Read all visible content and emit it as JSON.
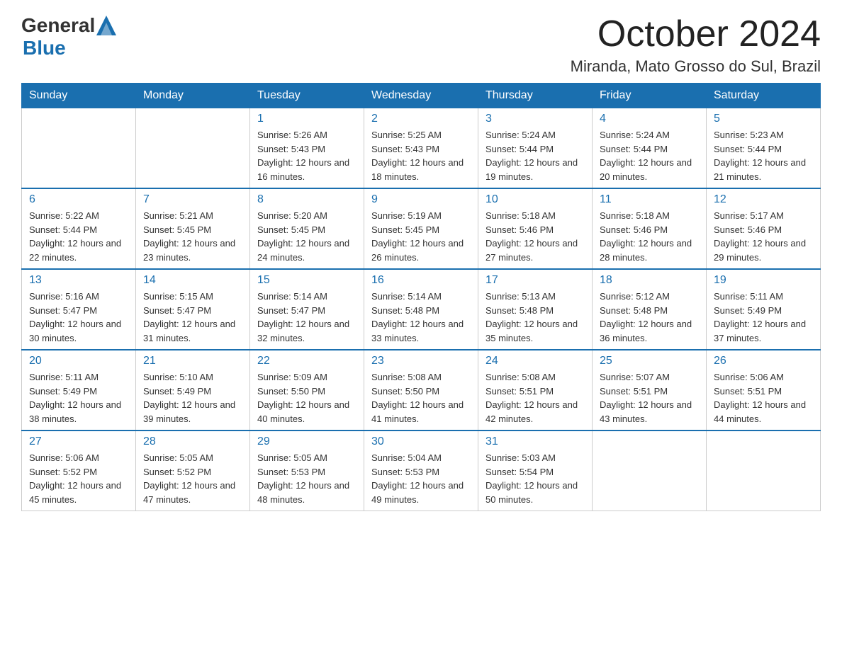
{
  "logo": {
    "text_general": "General",
    "text_blue": "Blue",
    "aria": "GeneralBlue logo"
  },
  "title": "October 2024",
  "subtitle": "Miranda, Mato Grosso do Sul, Brazil",
  "weekdays": [
    "Sunday",
    "Monday",
    "Tuesday",
    "Wednesday",
    "Thursday",
    "Friday",
    "Saturday"
  ],
  "weeks": [
    [
      {
        "day": "",
        "sunrise": "",
        "sunset": "",
        "daylight": ""
      },
      {
        "day": "",
        "sunrise": "",
        "sunset": "",
        "daylight": ""
      },
      {
        "day": "1",
        "sunrise": "Sunrise: 5:26 AM",
        "sunset": "Sunset: 5:43 PM",
        "daylight": "Daylight: 12 hours and 16 minutes."
      },
      {
        "day": "2",
        "sunrise": "Sunrise: 5:25 AM",
        "sunset": "Sunset: 5:43 PM",
        "daylight": "Daylight: 12 hours and 18 minutes."
      },
      {
        "day": "3",
        "sunrise": "Sunrise: 5:24 AM",
        "sunset": "Sunset: 5:44 PM",
        "daylight": "Daylight: 12 hours and 19 minutes."
      },
      {
        "day": "4",
        "sunrise": "Sunrise: 5:24 AM",
        "sunset": "Sunset: 5:44 PM",
        "daylight": "Daylight: 12 hours and 20 minutes."
      },
      {
        "day": "5",
        "sunrise": "Sunrise: 5:23 AM",
        "sunset": "Sunset: 5:44 PM",
        "daylight": "Daylight: 12 hours and 21 minutes."
      }
    ],
    [
      {
        "day": "6",
        "sunrise": "Sunrise: 5:22 AM",
        "sunset": "Sunset: 5:44 PM",
        "daylight": "Daylight: 12 hours and 22 minutes."
      },
      {
        "day": "7",
        "sunrise": "Sunrise: 5:21 AM",
        "sunset": "Sunset: 5:45 PM",
        "daylight": "Daylight: 12 hours and 23 minutes."
      },
      {
        "day": "8",
        "sunrise": "Sunrise: 5:20 AM",
        "sunset": "Sunset: 5:45 PM",
        "daylight": "Daylight: 12 hours and 24 minutes."
      },
      {
        "day": "9",
        "sunrise": "Sunrise: 5:19 AM",
        "sunset": "Sunset: 5:45 PM",
        "daylight": "Daylight: 12 hours and 26 minutes."
      },
      {
        "day": "10",
        "sunrise": "Sunrise: 5:18 AM",
        "sunset": "Sunset: 5:46 PM",
        "daylight": "Daylight: 12 hours and 27 minutes."
      },
      {
        "day": "11",
        "sunrise": "Sunrise: 5:18 AM",
        "sunset": "Sunset: 5:46 PM",
        "daylight": "Daylight: 12 hours and 28 minutes."
      },
      {
        "day": "12",
        "sunrise": "Sunrise: 5:17 AM",
        "sunset": "Sunset: 5:46 PM",
        "daylight": "Daylight: 12 hours and 29 minutes."
      }
    ],
    [
      {
        "day": "13",
        "sunrise": "Sunrise: 5:16 AM",
        "sunset": "Sunset: 5:47 PM",
        "daylight": "Daylight: 12 hours and 30 minutes."
      },
      {
        "day": "14",
        "sunrise": "Sunrise: 5:15 AM",
        "sunset": "Sunset: 5:47 PM",
        "daylight": "Daylight: 12 hours and 31 minutes."
      },
      {
        "day": "15",
        "sunrise": "Sunrise: 5:14 AM",
        "sunset": "Sunset: 5:47 PM",
        "daylight": "Daylight: 12 hours and 32 minutes."
      },
      {
        "day": "16",
        "sunrise": "Sunrise: 5:14 AM",
        "sunset": "Sunset: 5:48 PM",
        "daylight": "Daylight: 12 hours and 33 minutes."
      },
      {
        "day": "17",
        "sunrise": "Sunrise: 5:13 AM",
        "sunset": "Sunset: 5:48 PM",
        "daylight": "Daylight: 12 hours and 35 minutes."
      },
      {
        "day": "18",
        "sunrise": "Sunrise: 5:12 AM",
        "sunset": "Sunset: 5:48 PM",
        "daylight": "Daylight: 12 hours and 36 minutes."
      },
      {
        "day": "19",
        "sunrise": "Sunrise: 5:11 AM",
        "sunset": "Sunset: 5:49 PM",
        "daylight": "Daylight: 12 hours and 37 minutes."
      }
    ],
    [
      {
        "day": "20",
        "sunrise": "Sunrise: 5:11 AM",
        "sunset": "Sunset: 5:49 PM",
        "daylight": "Daylight: 12 hours and 38 minutes."
      },
      {
        "day": "21",
        "sunrise": "Sunrise: 5:10 AM",
        "sunset": "Sunset: 5:49 PM",
        "daylight": "Daylight: 12 hours and 39 minutes."
      },
      {
        "day": "22",
        "sunrise": "Sunrise: 5:09 AM",
        "sunset": "Sunset: 5:50 PM",
        "daylight": "Daylight: 12 hours and 40 minutes."
      },
      {
        "day": "23",
        "sunrise": "Sunrise: 5:08 AM",
        "sunset": "Sunset: 5:50 PM",
        "daylight": "Daylight: 12 hours and 41 minutes."
      },
      {
        "day": "24",
        "sunrise": "Sunrise: 5:08 AM",
        "sunset": "Sunset: 5:51 PM",
        "daylight": "Daylight: 12 hours and 42 minutes."
      },
      {
        "day": "25",
        "sunrise": "Sunrise: 5:07 AM",
        "sunset": "Sunset: 5:51 PM",
        "daylight": "Daylight: 12 hours and 43 minutes."
      },
      {
        "day": "26",
        "sunrise": "Sunrise: 5:06 AM",
        "sunset": "Sunset: 5:51 PM",
        "daylight": "Daylight: 12 hours and 44 minutes."
      }
    ],
    [
      {
        "day": "27",
        "sunrise": "Sunrise: 5:06 AM",
        "sunset": "Sunset: 5:52 PM",
        "daylight": "Daylight: 12 hours and 45 minutes."
      },
      {
        "day": "28",
        "sunrise": "Sunrise: 5:05 AM",
        "sunset": "Sunset: 5:52 PM",
        "daylight": "Daylight: 12 hours and 47 minutes."
      },
      {
        "day": "29",
        "sunrise": "Sunrise: 5:05 AM",
        "sunset": "Sunset: 5:53 PM",
        "daylight": "Daylight: 12 hours and 48 minutes."
      },
      {
        "day": "30",
        "sunrise": "Sunrise: 5:04 AM",
        "sunset": "Sunset: 5:53 PM",
        "daylight": "Daylight: 12 hours and 49 minutes."
      },
      {
        "day": "31",
        "sunrise": "Sunrise: 5:03 AM",
        "sunset": "Sunset: 5:54 PM",
        "daylight": "Daylight: 12 hours and 50 minutes."
      },
      {
        "day": "",
        "sunrise": "",
        "sunset": "",
        "daylight": ""
      },
      {
        "day": "",
        "sunrise": "",
        "sunset": "",
        "daylight": ""
      }
    ]
  ]
}
